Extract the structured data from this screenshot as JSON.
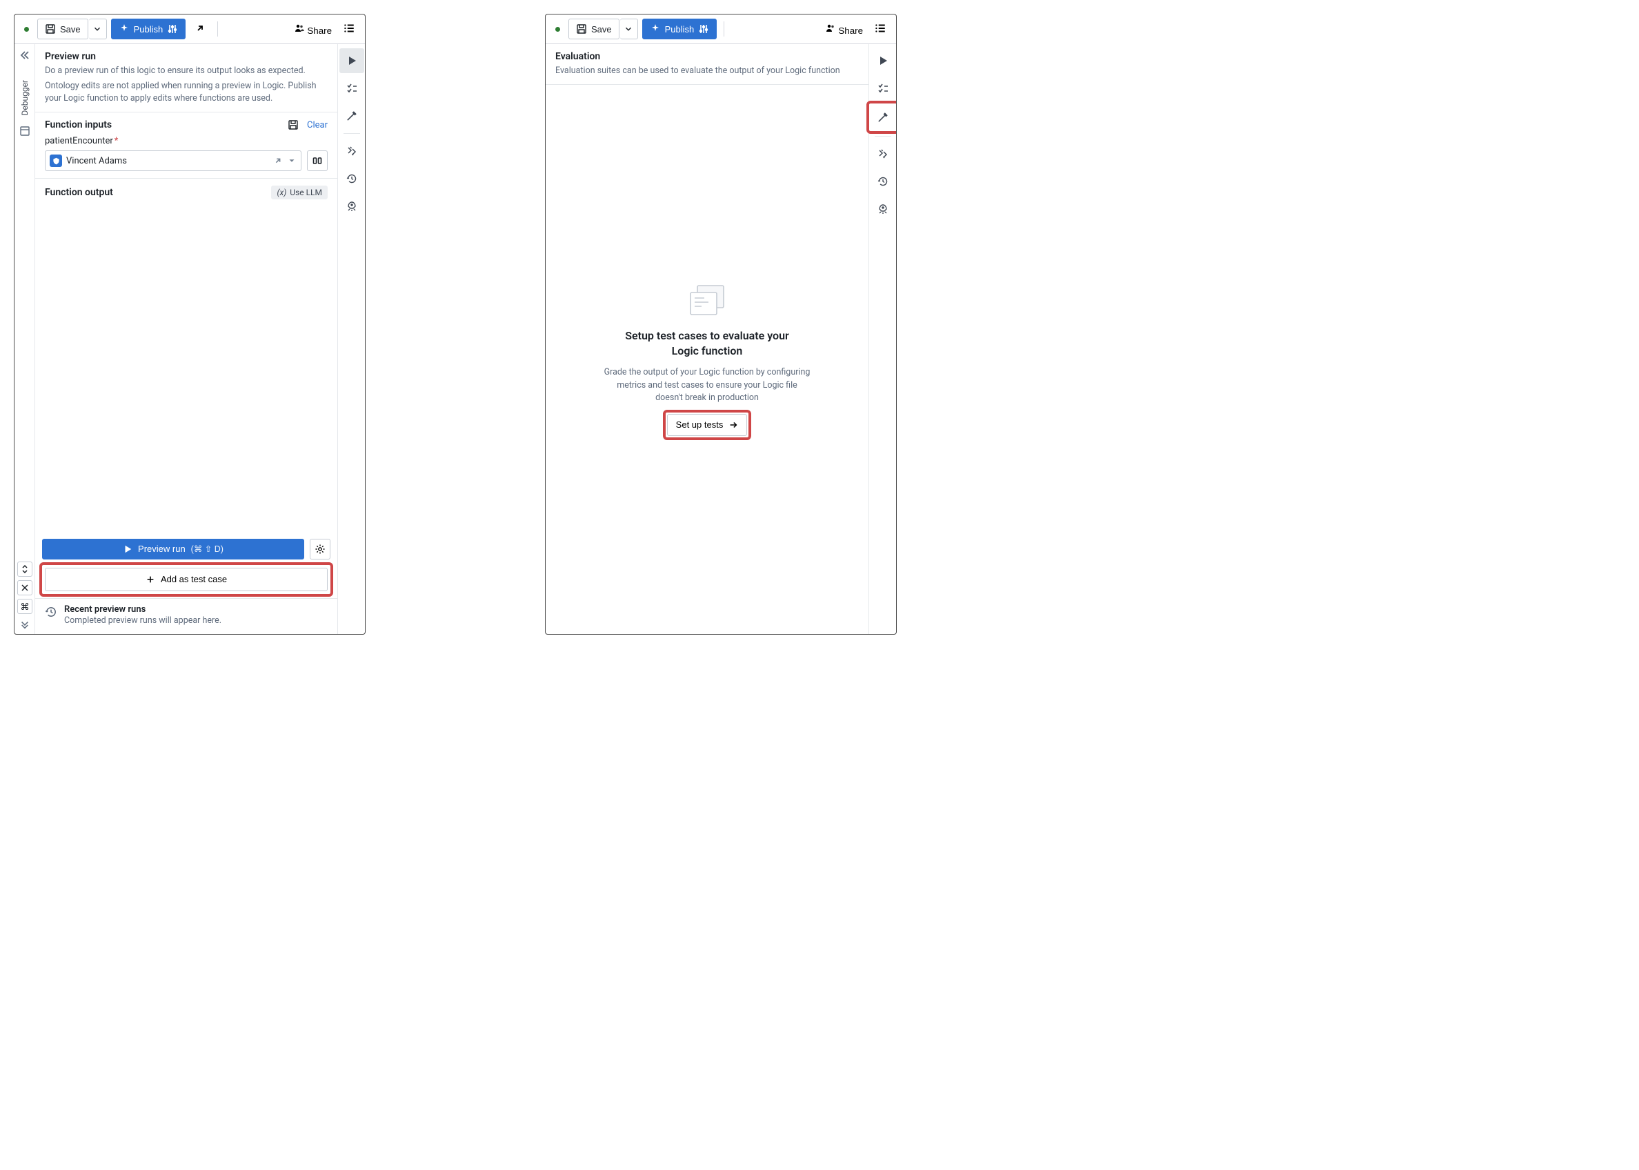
{
  "toolbar": {
    "save_label": "Save",
    "publish_label": "Publish",
    "share_label": "Share"
  },
  "left_rail": {
    "debugger_label": "Debugger"
  },
  "preview": {
    "title": "Preview run",
    "desc1": "Do a preview run of this logic to ensure its output looks as expected.",
    "desc2": "Ontology edits are not applied when running a preview in Logic. Publish your Logic function to apply edits where functions are used.",
    "inputs_title": "Function inputs",
    "clear_label": "Clear",
    "field_name": "patientEncounter",
    "field_value": "Vincent Adams",
    "output_title": "Function output",
    "use_llm_label": "Use LLM",
    "run_label": "Preview run",
    "run_shortcut": "(⌘ ⇧ D)",
    "add_testcase_label": "Add as test case",
    "recent_title": "Recent preview runs",
    "recent_sub": "Completed preview runs will appear here."
  },
  "evaluation": {
    "title": "Evaluation",
    "desc": "Evaluation suites can be used to evaluate the output of your Logic function",
    "empty_title": "Setup test cases to evaluate your Logic function",
    "empty_sub": "Grade the output of your Logic function by configuring metrics and test cases to ensure your Logic file doesn't break in production",
    "setup_label": "Set up tests"
  }
}
